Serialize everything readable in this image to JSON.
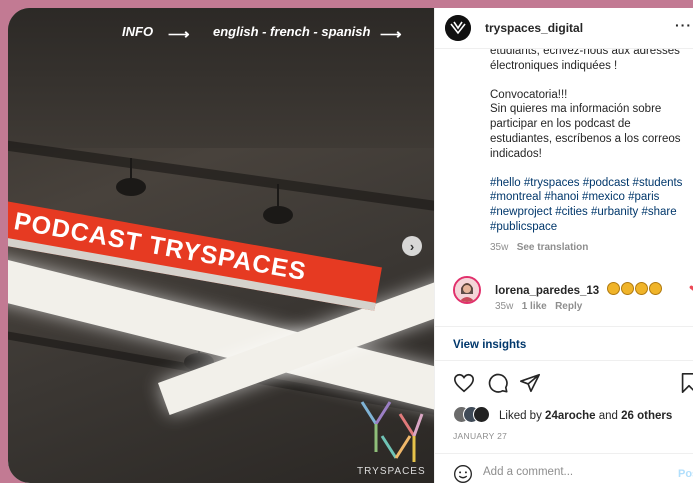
{
  "photo": {
    "info_label": "INFO",
    "languages": "english - french - spanish",
    "sign_text": "PODCAST TRYSPACES",
    "logo_text": "TRYSPACES"
  },
  "header": {
    "username": "tryspaces_digital",
    "more_label": "···"
  },
  "caption": {
    "lines_fr": "étudiants, écrivez-nous aux adresses électroniques indiquées !",
    "es_title": "Convocatoria!!!",
    "es_body": "Sin quieres ma información sobre participar en los podcast de estudiantes, escríbenos a los correos indicados!",
    "hashtags": "#hello #tryspaces #podcast #students #montreal #hanoi #mexico #paris #newproject #cities #urbanity #share #publicspace",
    "age": "35w",
    "see_translation": "See translation"
  },
  "comment": {
    "username": "lorena_paredes_13",
    "age": "35w",
    "likes": "1 like",
    "reply": "Reply"
  },
  "insights_label": "View insights",
  "likes": {
    "prefix": "Liked by",
    "user": "24aroche",
    "middle": "and",
    "others": "26 others"
  },
  "date": "JANUARY 27",
  "add_comment": {
    "placeholder": "Add a comment...",
    "post_label": "Post"
  },
  "colors": {
    "sign": "#e63a22",
    "link": "#00376b",
    "frame": "#c27a93"
  }
}
